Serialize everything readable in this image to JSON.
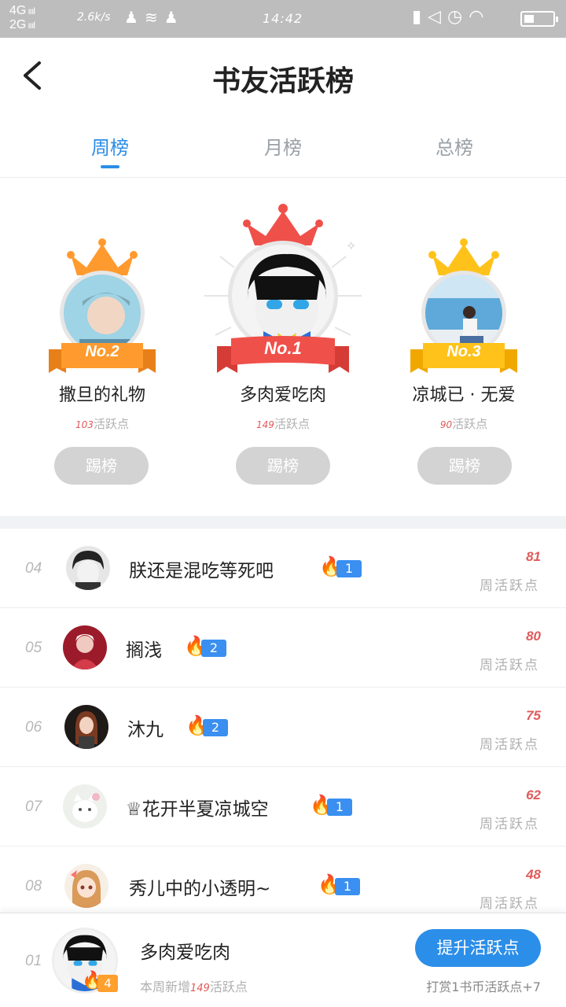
{
  "status_bar": {
    "net1": "4G",
    "net2": "2G",
    "speed": "2.6k/s",
    "time": "14:42"
  },
  "header": {
    "back_icon": "‹",
    "title": "书友活跃榜"
  },
  "tabs": [
    {
      "label": "周榜",
      "active": true
    },
    {
      "label": "月榜",
      "active": false
    },
    {
      "label": "总榜",
      "active": false
    }
  ],
  "podium": {
    "first": {
      "rank": "No.1",
      "name": "多肉爱吃肉",
      "points": "149",
      "points_label": "活跃点",
      "button": "踢榜"
    },
    "second": {
      "rank": "No.2",
      "name": "撒旦的礼物",
      "points": "103",
      "points_label": "活跃点",
      "button": "踢榜"
    },
    "third": {
      "rank": "No.3",
      "name": "凉城已 · 无爱",
      "points": "90",
      "points_label": "活跃点",
      "button": "踢榜"
    }
  },
  "list": [
    {
      "rank": "04",
      "name": "朕还是混吃等死吧",
      "level": "1",
      "value": "81",
      "label": "周活跃点"
    },
    {
      "rank": "05",
      "name": "搁浅",
      "level": "2",
      "value": "80",
      "label": "周活跃点"
    },
    {
      "rank": "06",
      "name": "沐九",
      "level": "2",
      "value": "75",
      "label": "周活跃点"
    },
    {
      "rank": "07",
      "name": "♕花开半夏凉城空",
      "level": "1",
      "value": "62",
      "label": "周活跃点"
    },
    {
      "rank": "08",
      "name": "秀儿中的小透明~",
      "level": "1",
      "value": "48",
      "label": "周活跃点"
    }
  ],
  "me": {
    "rank": "01",
    "name": "多肉爱吃肉",
    "level": "4",
    "note_prefix": "本周新增",
    "note_points": "149",
    "note_suffix": "活跃点",
    "boost_button": "提升活跃点",
    "tip": "打赏1书币活跃点+7"
  },
  "colors": {
    "accent": "#2b8ee8",
    "gold_crown": "#ff9a2e",
    "red_crown": "#f0504a",
    "points_red": "#e05a5a"
  }
}
